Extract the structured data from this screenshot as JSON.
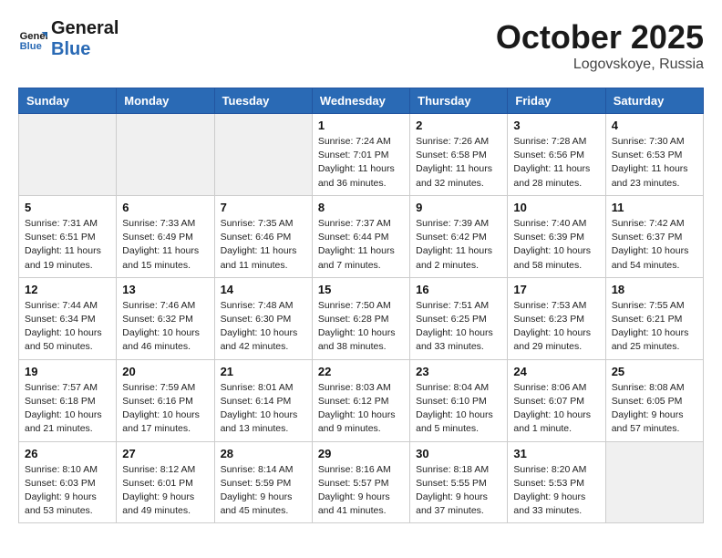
{
  "header": {
    "logo_line1": "General",
    "logo_line2": "Blue",
    "month": "October 2025",
    "location": "Logovskoye, Russia"
  },
  "weekdays": [
    "Sunday",
    "Monday",
    "Tuesday",
    "Wednesday",
    "Thursday",
    "Friday",
    "Saturday"
  ],
  "weeks": [
    [
      {
        "day": "",
        "info": ""
      },
      {
        "day": "",
        "info": ""
      },
      {
        "day": "",
        "info": ""
      },
      {
        "day": "1",
        "info": "Sunrise: 7:24 AM\nSunset: 7:01 PM\nDaylight: 11 hours\nand 36 minutes."
      },
      {
        "day": "2",
        "info": "Sunrise: 7:26 AM\nSunset: 6:58 PM\nDaylight: 11 hours\nand 32 minutes."
      },
      {
        "day": "3",
        "info": "Sunrise: 7:28 AM\nSunset: 6:56 PM\nDaylight: 11 hours\nand 28 minutes."
      },
      {
        "day": "4",
        "info": "Sunrise: 7:30 AM\nSunset: 6:53 PM\nDaylight: 11 hours\nand 23 minutes."
      }
    ],
    [
      {
        "day": "5",
        "info": "Sunrise: 7:31 AM\nSunset: 6:51 PM\nDaylight: 11 hours\nand 19 minutes."
      },
      {
        "day": "6",
        "info": "Sunrise: 7:33 AM\nSunset: 6:49 PM\nDaylight: 11 hours\nand 15 minutes."
      },
      {
        "day": "7",
        "info": "Sunrise: 7:35 AM\nSunset: 6:46 PM\nDaylight: 11 hours\nand 11 minutes."
      },
      {
        "day": "8",
        "info": "Sunrise: 7:37 AM\nSunset: 6:44 PM\nDaylight: 11 hours\nand 7 minutes."
      },
      {
        "day": "9",
        "info": "Sunrise: 7:39 AM\nSunset: 6:42 PM\nDaylight: 11 hours\nand 2 minutes."
      },
      {
        "day": "10",
        "info": "Sunrise: 7:40 AM\nSunset: 6:39 PM\nDaylight: 10 hours\nand 58 minutes."
      },
      {
        "day": "11",
        "info": "Sunrise: 7:42 AM\nSunset: 6:37 PM\nDaylight: 10 hours\nand 54 minutes."
      }
    ],
    [
      {
        "day": "12",
        "info": "Sunrise: 7:44 AM\nSunset: 6:34 PM\nDaylight: 10 hours\nand 50 minutes."
      },
      {
        "day": "13",
        "info": "Sunrise: 7:46 AM\nSunset: 6:32 PM\nDaylight: 10 hours\nand 46 minutes."
      },
      {
        "day": "14",
        "info": "Sunrise: 7:48 AM\nSunset: 6:30 PM\nDaylight: 10 hours\nand 42 minutes."
      },
      {
        "day": "15",
        "info": "Sunrise: 7:50 AM\nSunset: 6:28 PM\nDaylight: 10 hours\nand 38 minutes."
      },
      {
        "day": "16",
        "info": "Sunrise: 7:51 AM\nSunset: 6:25 PM\nDaylight: 10 hours\nand 33 minutes."
      },
      {
        "day": "17",
        "info": "Sunrise: 7:53 AM\nSunset: 6:23 PM\nDaylight: 10 hours\nand 29 minutes."
      },
      {
        "day": "18",
        "info": "Sunrise: 7:55 AM\nSunset: 6:21 PM\nDaylight: 10 hours\nand 25 minutes."
      }
    ],
    [
      {
        "day": "19",
        "info": "Sunrise: 7:57 AM\nSunset: 6:18 PM\nDaylight: 10 hours\nand 21 minutes."
      },
      {
        "day": "20",
        "info": "Sunrise: 7:59 AM\nSunset: 6:16 PM\nDaylight: 10 hours\nand 17 minutes."
      },
      {
        "day": "21",
        "info": "Sunrise: 8:01 AM\nSunset: 6:14 PM\nDaylight: 10 hours\nand 13 minutes."
      },
      {
        "day": "22",
        "info": "Sunrise: 8:03 AM\nSunset: 6:12 PM\nDaylight: 10 hours\nand 9 minutes."
      },
      {
        "day": "23",
        "info": "Sunrise: 8:04 AM\nSunset: 6:10 PM\nDaylight: 10 hours\nand 5 minutes."
      },
      {
        "day": "24",
        "info": "Sunrise: 8:06 AM\nSunset: 6:07 PM\nDaylight: 10 hours\nand 1 minute."
      },
      {
        "day": "25",
        "info": "Sunrise: 8:08 AM\nSunset: 6:05 PM\nDaylight: 9 hours\nand 57 minutes."
      }
    ],
    [
      {
        "day": "26",
        "info": "Sunrise: 8:10 AM\nSunset: 6:03 PM\nDaylight: 9 hours\nand 53 minutes."
      },
      {
        "day": "27",
        "info": "Sunrise: 8:12 AM\nSunset: 6:01 PM\nDaylight: 9 hours\nand 49 minutes."
      },
      {
        "day": "28",
        "info": "Sunrise: 8:14 AM\nSunset: 5:59 PM\nDaylight: 9 hours\nand 45 minutes."
      },
      {
        "day": "29",
        "info": "Sunrise: 8:16 AM\nSunset: 5:57 PM\nDaylight: 9 hours\nand 41 minutes."
      },
      {
        "day": "30",
        "info": "Sunrise: 8:18 AM\nSunset: 5:55 PM\nDaylight: 9 hours\nand 37 minutes."
      },
      {
        "day": "31",
        "info": "Sunrise: 8:20 AM\nSunset: 5:53 PM\nDaylight: 9 hours\nand 33 minutes."
      },
      {
        "day": "",
        "info": ""
      }
    ]
  ]
}
